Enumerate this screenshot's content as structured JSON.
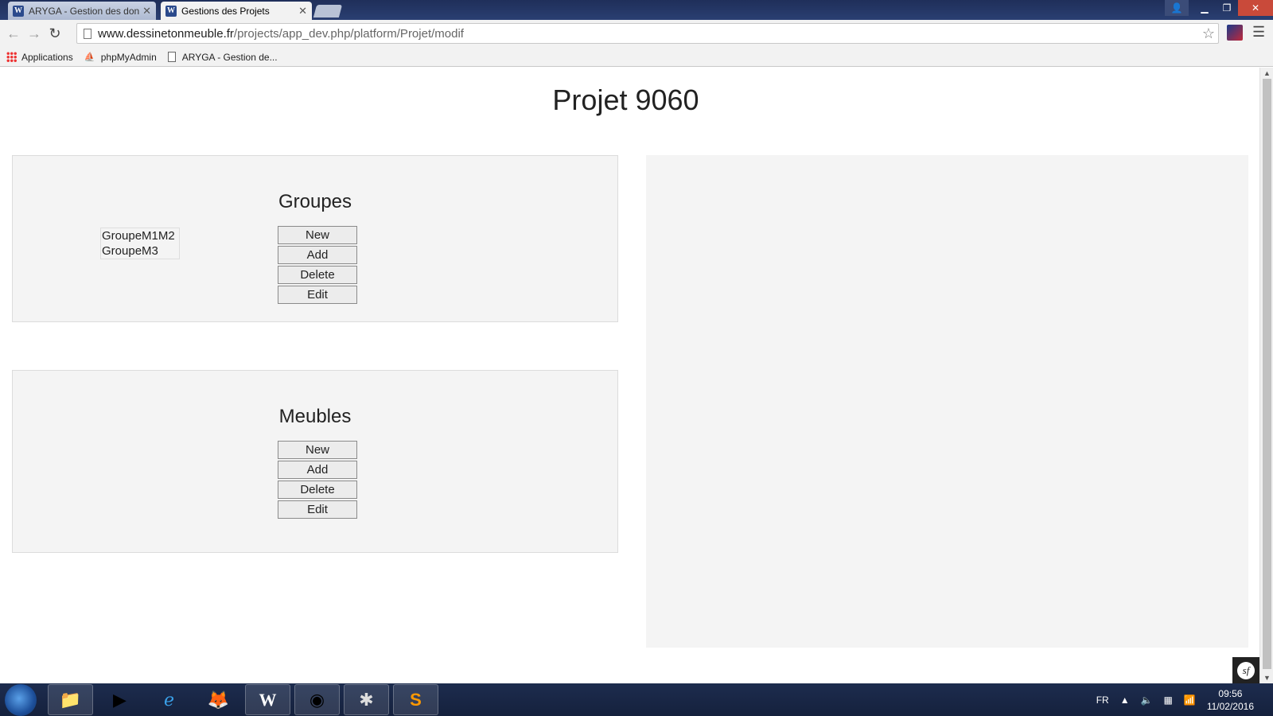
{
  "browser": {
    "tabs": [
      {
        "title": "ARYGA - Gestion des don",
        "active": false,
        "favicon": "W"
      },
      {
        "title": "Gestions des Projets",
        "active": true,
        "favicon": "W"
      }
    ],
    "url_host": "www.dessinetonmeuble.fr",
    "url_path": "/projects/app_dev.php/platform/Projet/modif",
    "bookmarks": [
      {
        "label": "Applications",
        "icon": "apps-icon"
      },
      {
        "label": "phpMyAdmin",
        "icon": "phpmyadmin-icon"
      },
      {
        "label": "ARYGA - Gestion de...",
        "icon": "document-icon"
      }
    ]
  },
  "page": {
    "title": "Projet 9060",
    "groups": {
      "heading": "Groupes",
      "items": [
        "GroupeM1M2",
        "GroupeM3"
      ],
      "buttons": {
        "new": "New",
        "add": "Add",
        "delete": "Delete",
        "edit": "Edit"
      }
    },
    "meubles": {
      "heading": "Meubles",
      "buttons": {
        "new": "New",
        "add": "Add",
        "delete": "Delete",
        "edit": "Edit"
      }
    }
  },
  "taskbar": {
    "apps": [
      "explorer",
      "media-player",
      "internet-explorer",
      "firefox",
      "word",
      "chrome",
      "wamp",
      "sublime-text"
    ],
    "language": "FR",
    "time": "09:56",
    "date": "11/02/2016"
  }
}
